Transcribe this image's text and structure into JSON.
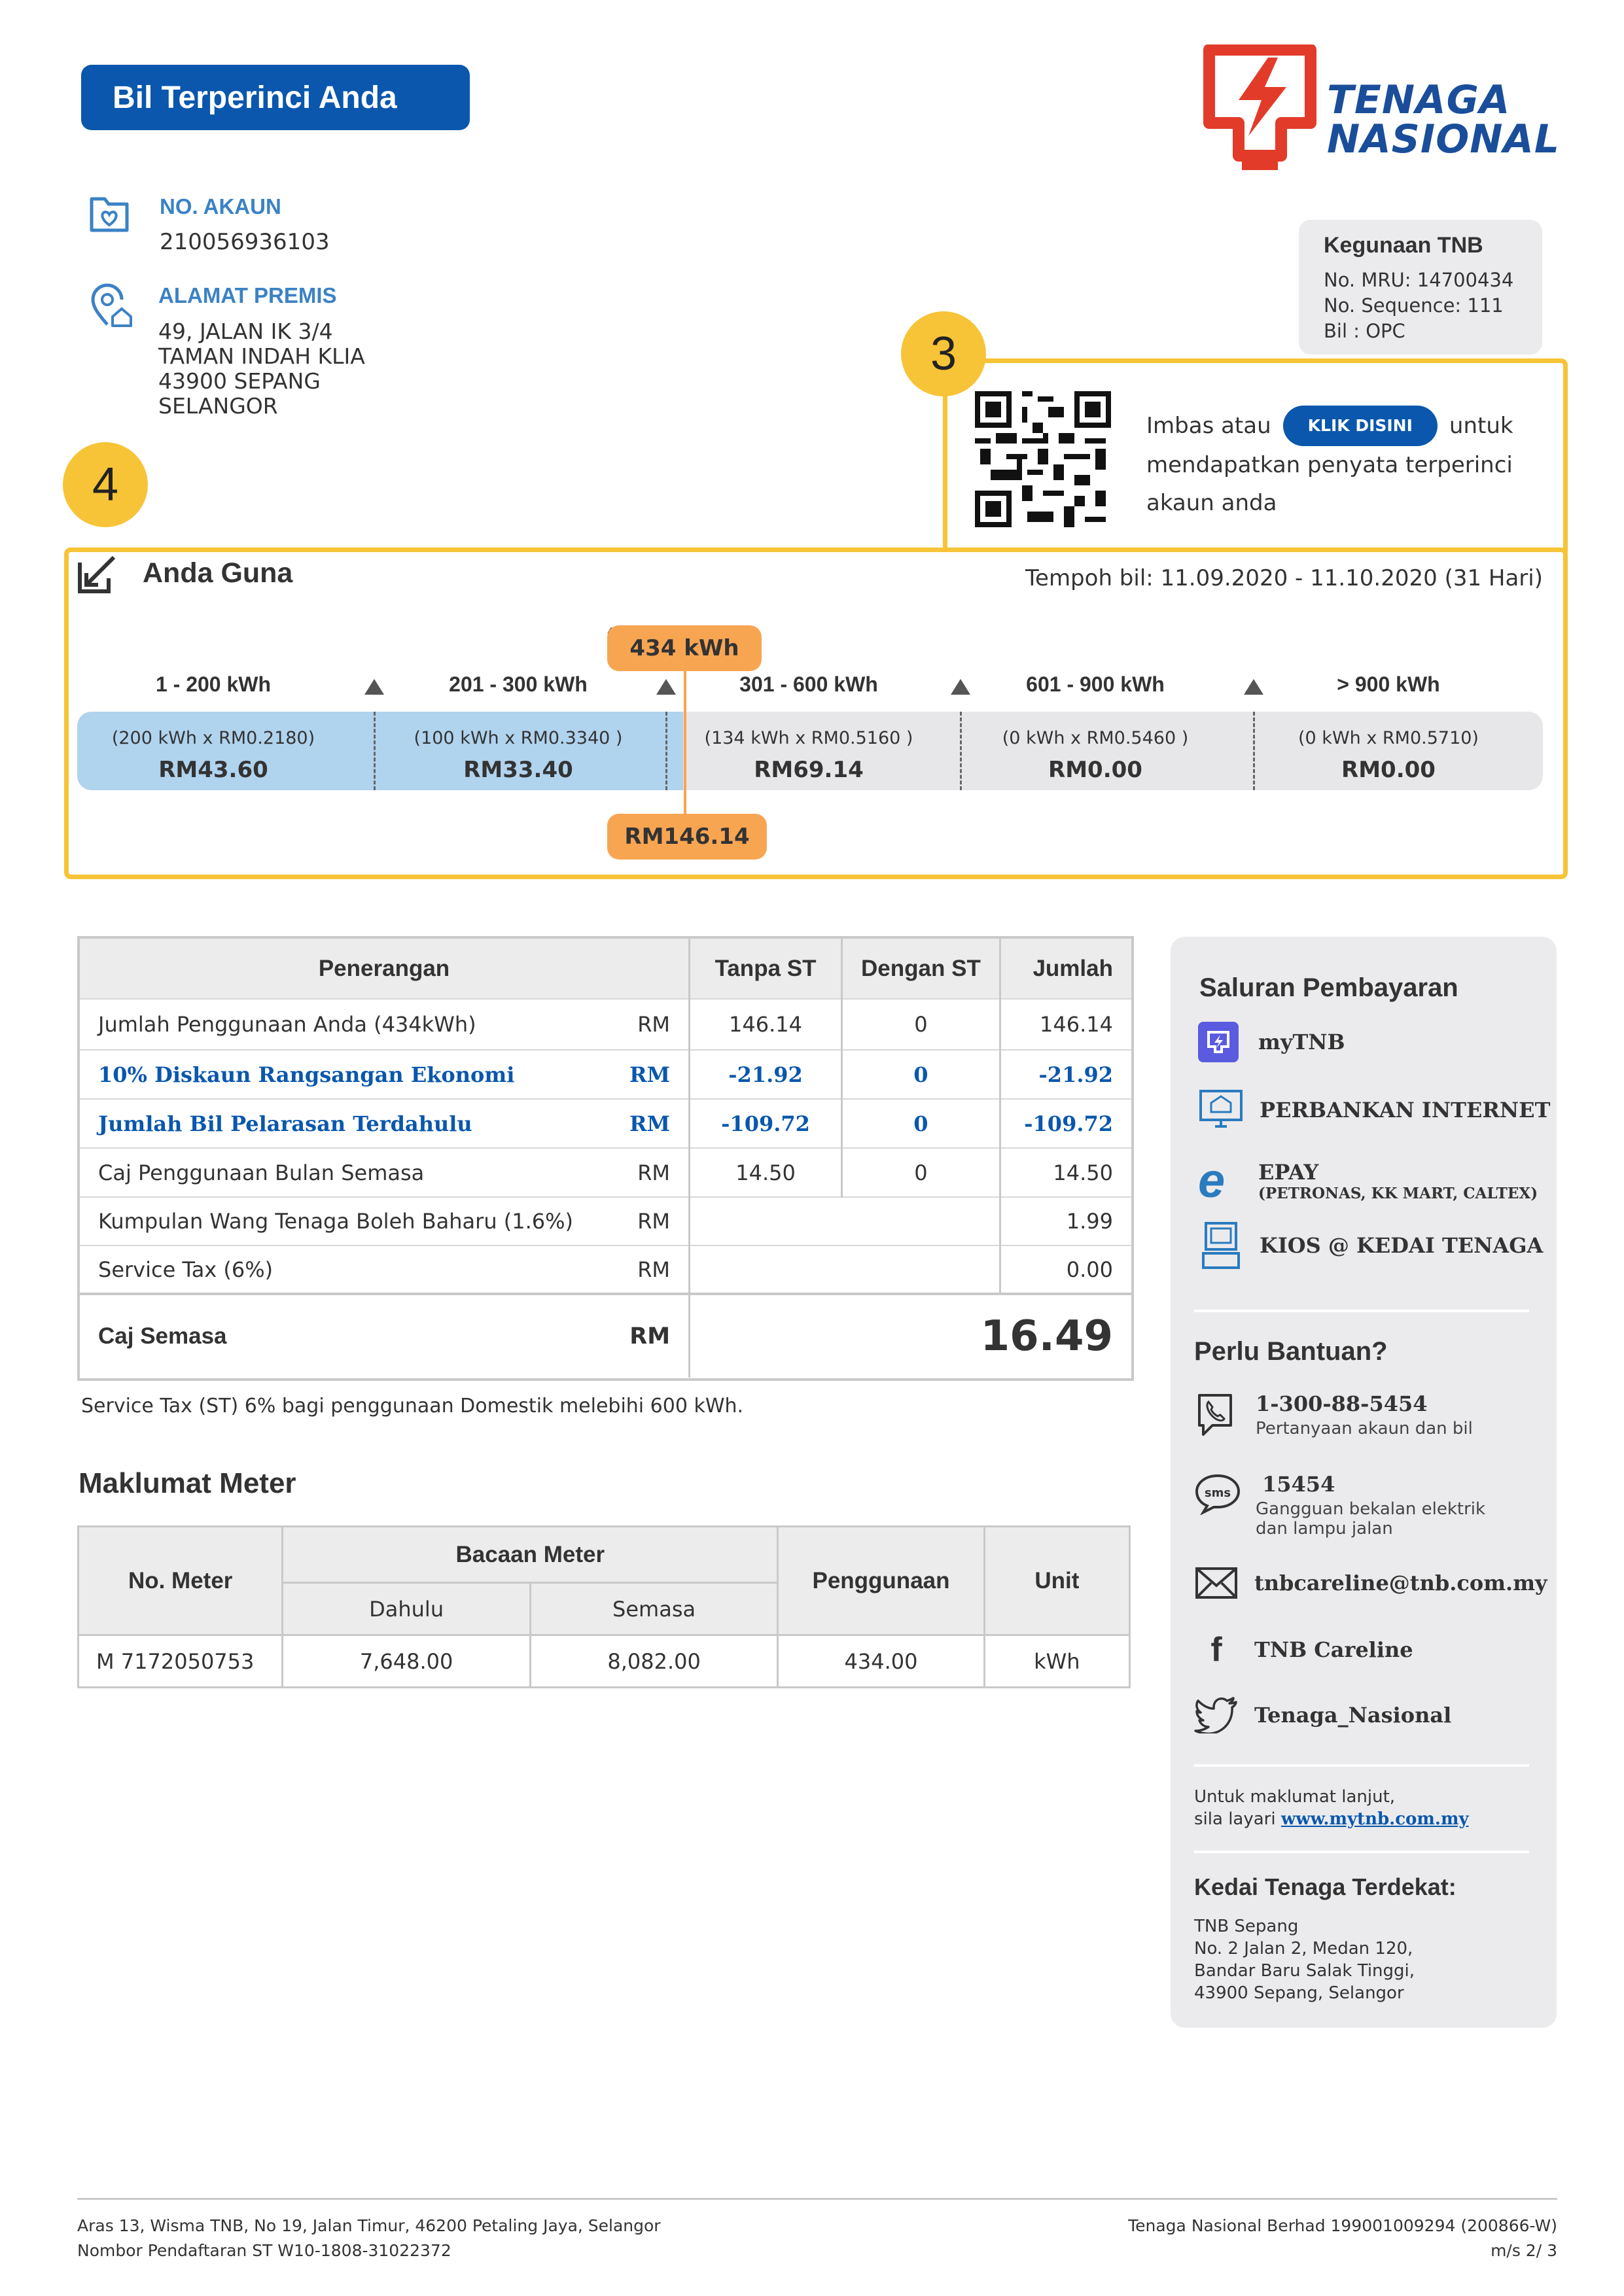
{
  "header": {
    "title": "Bil Terperinci Anda",
    "logo_line1": "TENAGA",
    "logo_line2": "NASIONAL"
  },
  "account": {
    "no_label": "NO. AKAUN",
    "no_value": "210056936103",
    "address_label": "ALAMAT PREMIS",
    "address": [
      "49, JALAN IK 3/4",
      "TAMAN INDAH KLIA",
      "43900 SEPANG",
      "SELANGOR"
    ]
  },
  "tnb_use": {
    "title": "Kegunaan TNB",
    "mru": "No. MRU: 14700434",
    "sequence": "No. Sequence: 111",
    "bil": "Bil : OPC"
  },
  "callouts": {
    "three": "3",
    "four": "4"
  },
  "qr": {
    "text_before": "Imbas atau",
    "button": "KLIK DISINI",
    "text_after": "untuk",
    "line2": "mendapatkan penyata terperinci",
    "line3": "akaun anda"
  },
  "usage": {
    "title": "Anda Guna",
    "period": "Tempoh bil: 11.09.2020 - 11.10.2020 (31 Hari)",
    "marker_kwh": "434 kWh",
    "marker_rm": "RM146.14",
    "marker_value_kwh": 434,
    "tiers": [
      {
        "range": "1 - 200 kWh",
        "formula": "(200 kWh x RM0.2180)",
        "amount": "RM43.60",
        "used": true
      },
      {
        "range": "201 - 300 kWh",
        "formula": "(100 kWh x RM0.3340 )",
        "amount": "RM33.40",
        "used": true
      },
      {
        "range": "301 - 600 kWh",
        "formula": "(134 kWh x RM0.5160 )",
        "amount": "RM69.14",
        "used": false
      },
      {
        "range": "601 - 900 kWh",
        "formula": "(0 kWh x RM0.5460 )",
        "amount": "RM0.00",
        "used": false
      },
      {
        "range": "> 900 kWh",
        "formula": "(0 kWh x RM0.5710)",
        "amount": "RM0.00",
        "used": false
      }
    ]
  },
  "bill": {
    "headers": [
      "Penerangan",
      "Tanpa ST",
      "Dengan ST",
      "Jumlah"
    ],
    "rows": [
      {
        "desc": "Jumlah Penggunaan Anda (434kWh)",
        "cur": "RM",
        "tanpa": "146.14",
        "dengan": "0",
        "jumlah": "146.14",
        "blue": false
      },
      {
        "desc": "10% Diskaun Rangsangan Ekonomi",
        "cur": "RM",
        "tanpa": "-21.92",
        "dengan": "0",
        "jumlah": "-21.92",
        "blue": true
      },
      {
        "desc": "Jumlah Bil Pelarasan Terdahulu",
        "cur": "RM",
        "tanpa": "-109.72",
        "dengan": "0",
        "jumlah": "-109.72",
        "blue": true
      },
      {
        "desc": "Caj Penggunaan Bulan Semasa",
        "cur": "RM",
        "tanpa": "14.50",
        "dengan": "0",
        "jumlah": "14.50",
        "blue": false
      },
      {
        "desc": "Kumpulan Wang Tenaga Boleh Baharu (1.6%)",
        "cur": "RM",
        "tanpa": "",
        "dengan": "",
        "jumlah": "1.99",
        "blue": false
      },
      {
        "desc": "Service Tax (6%)",
        "cur": "RM",
        "tanpa": "",
        "dengan": "",
        "jumlah": "0.00",
        "blue": false
      }
    ],
    "total_label": "Caj Semasa",
    "total_cur": "RM",
    "total_value": "16.49",
    "note": "Service Tax (ST) 6% bagi penggunaan Domestik melebihi 600 kWh."
  },
  "meter": {
    "title": "Maklumat Meter",
    "h_no": "No. Meter",
    "h_bacaan": "Bacaan Meter",
    "h_dahulu": "Dahulu",
    "h_semasa": "Semasa",
    "h_penggunaan": "Penggunaan",
    "h_unit": "Unit",
    "no": "M 7172050753",
    "dahulu": "7,648.00",
    "semasa": "8,082.00",
    "penggunaan": "434.00",
    "unit": "kWh"
  },
  "sidebar": {
    "pay_title": "Saluran Pembayaran",
    "pay": [
      "myTNB",
      "PERBANKAN INTERNET",
      "EPAY",
      "KIOS @ KEDAI TENAGA"
    ],
    "epay_sub": "(PETRONAS, KK MART, CALTEX)",
    "help_title": "Perlu Bantuan?",
    "phone": "1-300-88-5454",
    "phone_sub": "Pertanyaan akaun dan bil",
    "sms": "15454",
    "sms_sub1": "Gangguan bekalan elektrik",
    "sms_sub2": "dan lampu jalan",
    "email": "tnbcareline@tnb.com.my",
    "facebook": "TNB Careline",
    "twitter": "Tenaga_Nasional",
    "info1": "Untuk maklumat lanjut,",
    "info2": "sila layari",
    "info_link": "www.mytnb.com.my",
    "shop_title": "Kedai Tenaga Terdekat:",
    "shop": [
      "TNB Sepang",
      "No. 2 Jalan 2, Medan 120,",
      "Bandar Baru Salak Tinggi,",
      "43900 Sepang, Selangor"
    ]
  },
  "footer": {
    "left1": "Aras 13, Wisma TNB, No 19, Jalan Timur, 46200 Petaling Jaya, Selangor",
    "left2": "Nombor Pendaftaran ST W10-1808-31022372",
    "right1": "Tenaga Nasional Berhad 199001009294 (200866-W)",
    "right2": "m/s 2/ 3"
  },
  "colors": {
    "blue": "#0a57ad",
    "yellow": "#f7c437",
    "orange": "#f8a552",
    "tier_used": "#b0d3ee",
    "tier_unused": "#e7e7e9",
    "logo_red": "#e23b2a",
    "logo_blue": "#1a4e9a"
  }
}
